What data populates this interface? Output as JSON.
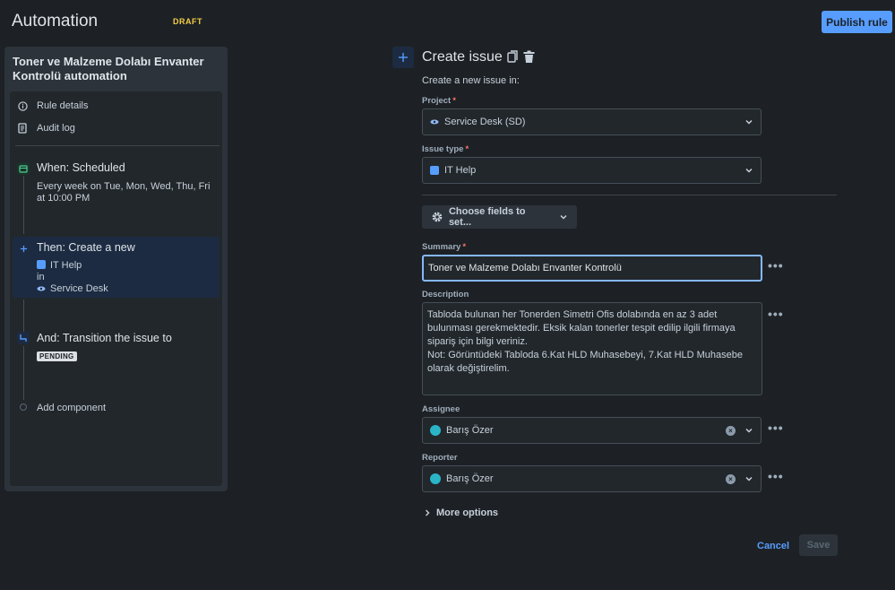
{
  "header": {
    "title": "Automation",
    "status_badge": "DRAFT",
    "publish_label": "Publish rule"
  },
  "sidebar": {
    "rule_name": "Toner ve Malzeme Dolabı Envanter Kontrolü automation",
    "menu": [
      {
        "label": "Rule details",
        "icon": "info-icon"
      },
      {
        "label": "Audit log",
        "icon": "document-icon"
      }
    ],
    "trigger": {
      "title": "When: Scheduled",
      "description": "Every week on Tue, Mon, Wed, Thu, Fri at 10:00 PM",
      "icon": "calendar-icon",
      "color": "#4bce97"
    },
    "action": {
      "title": "Then: Create a new",
      "issue_type": "IT Help",
      "connector": "in",
      "project": "Service Desk",
      "icon": "plus-icon"
    },
    "branch": {
      "title": "And: Transition the issue to",
      "status": "PENDING",
      "icon": "transition-icon"
    },
    "add_component": "Add component"
  },
  "form": {
    "title": "Create issue",
    "subtitle": "Create a new issue in:",
    "project": {
      "label": "Project",
      "value": "Service Desk (SD)"
    },
    "issue_type": {
      "label": "Issue type",
      "value": "IT Help"
    },
    "choose_fields": "Choose fields to set...",
    "summary": {
      "label": "Summary",
      "value": "Toner ve Malzeme Dolabı Envanter Kontrolü"
    },
    "description": {
      "label": "Description",
      "lines": [
        "Tabloda bulunan her Tonerden Simetri Ofis dolabında en az 3 adet",
        "bulunması gerekmektedir. Eksik kalan tonerler tespit edilip ilgili firmaya",
        "sipariş için bilgi veriniz.",
        "Not: Görüntüdeki Tabloda 6.Kat HLD Muhasebeyi, 7.Kat HLD Muhasebe",
        "olarak değiştirelim."
      ]
    },
    "assignee": {
      "label": "Assignee",
      "value": "Barış Özer"
    },
    "reporter": {
      "label": "Reporter",
      "value": "Barış Özer"
    },
    "more_options": "More options",
    "cancel_label": "Cancel",
    "save_label": "Save",
    "more_actions": "•••"
  },
  "colors": {
    "accent": "#579dff",
    "background": "#1d2125",
    "required": "#f87168"
  }
}
